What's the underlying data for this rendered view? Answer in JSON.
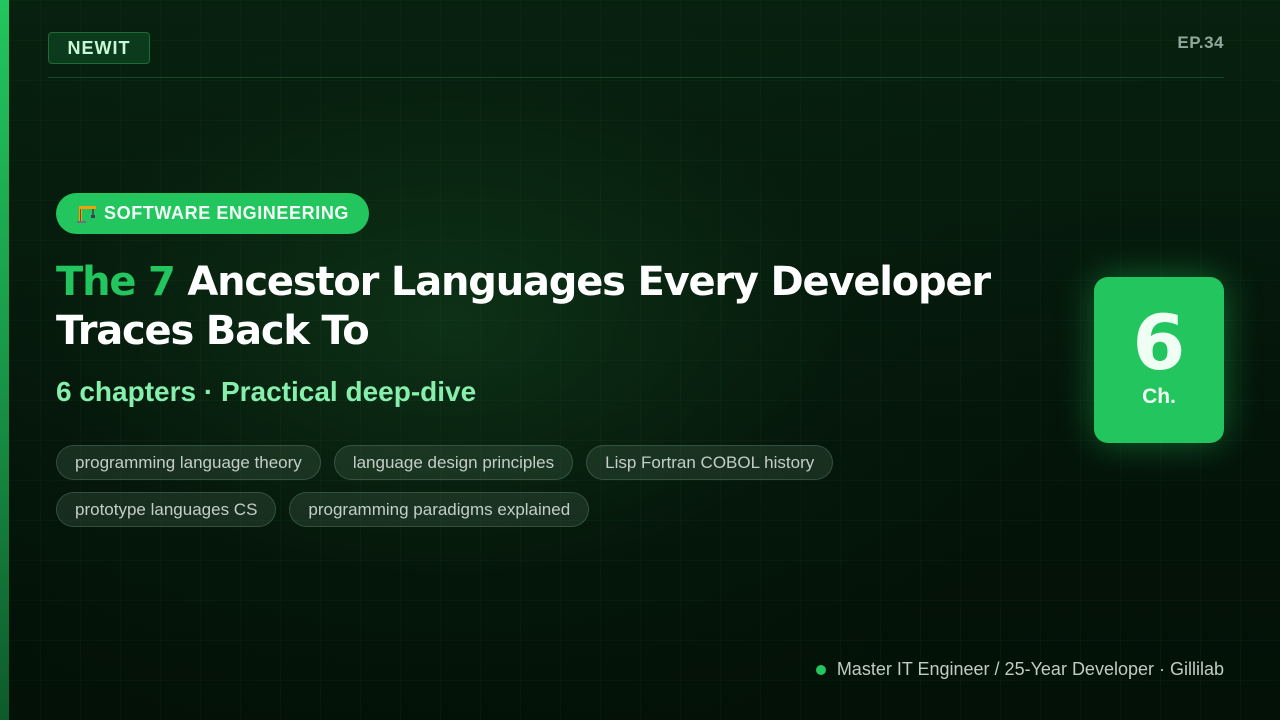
{
  "brand": {
    "logo": "NEWIT"
  },
  "episode": "EP.34",
  "category": {
    "icon": "construction-crane-icon",
    "label": "SOFTWARE ENGINEERING"
  },
  "title": {
    "highlight": "The 7",
    "rest": "Ancestor Languages Every Developer Traces Back To"
  },
  "subtitle": "6 chapters · Practical deep-dive",
  "tags": [
    "programming language theory",
    "language design principles",
    "Lisp Fortran COBOL history",
    "prototype languages CS",
    "programming paradigms explained"
  ],
  "chapter_badge": {
    "number": "6",
    "label": "Ch."
  },
  "footer": {
    "author": "Master IT Engineer / 25-Year Developer · Gillilab"
  },
  "colors": {
    "accent": "#22c55e",
    "subtitle": "#86efac",
    "background": "#041408"
  }
}
